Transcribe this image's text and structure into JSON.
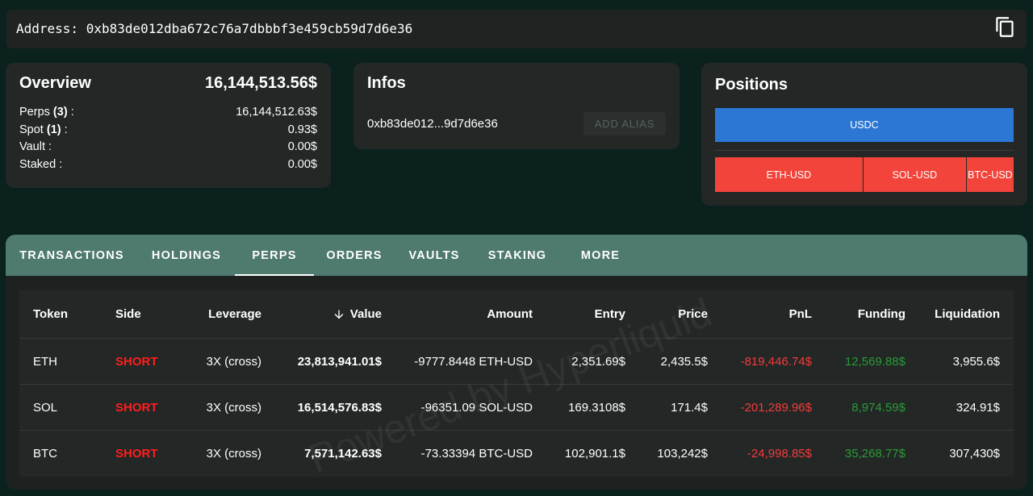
{
  "address_bar": {
    "label": "Address:",
    "address": "0xb83de012dba672c76a7dbbbf3e459cb59d7d6e36"
  },
  "overview": {
    "title": "Overview",
    "total": "16,144,513.56$",
    "rows": [
      {
        "label": "Perps",
        "count": "(3)",
        "sep": ":",
        "value": "16,144,512.63$"
      },
      {
        "label": "Spot",
        "count": "(1)",
        "sep": ":",
        "value": "0.93$"
      },
      {
        "label": "Vault",
        "count": "",
        "sep": ":",
        "value": "0.00$"
      },
      {
        "label": "Staked",
        "count": "",
        "sep": ":",
        "value": "0.00$"
      }
    ]
  },
  "infos": {
    "title": "Infos",
    "short_address": "0xb83de012...9d7d6e36",
    "add_alias_label": "ADD ALIAS"
  },
  "positions": {
    "title": "Positions",
    "spot": [
      {
        "label": "USDC",
        "share": 1.0
      }
    ],
    "perps": [
      {
        "label": "ETH-USD",
        "share": 0.497
      },
      {
        "label": "SOL-USD",
        "share": 0.345
      },
      {
        "label": "BTC-USD",
        "share": 0.158
      }
    ]
  },
  "tabs": {
    "items": [
      "TRANSACTIONS",
      "HOLDINGS",
      "PERPS",
      "ORDERS",
      "VAULTS",
      "STAKING",
      "MORE"
    ],
    "active": "PERPS"
  },
  "perps_table": {
    "columns": [
      "Token",
      "Side",
      "Leverage",
      "Value",
      "Amount",
      "Entry",
      "Price",
      "PnL",
      "Funding",
      "Liquidation"
    ],
    "rows": [
      {
        "token": "ETH",
        "side": "SHORT",
        "leverage": "3X (cross)",
        "value": "23,813,941.01$",
        "amount": "-9777.8448 ETH-USD",
        "entry": "2,351.69$",
        "price": "2,435.5$",
        "pnl": "-819,446.74$",
        "funding": "12,569.88$",
        "liquidation": "3,955.6$"
      },
      {
        "token": "SOL",
        "side": "SHORT",
        "leverage": "3X (cross)",
        "value": "16,514,576.83$",
        "amount": "-96351.09 SOL-USD",
        "entry": "169.3108$",
        "price": "171.4$",
        "pnl": "-201,289.96$",
        "funding": "8,974.59$",
        "liquidation": "324.91$"
      },
      {
        "token": "BTC",
        "side": "SHORT",
        "leverage": "3X (cross)",
        "value": "7,571,142.63$",
        "amount": "-73.33394 BTC-USD",
        "entry": "102,901.1$",
        "price": "103,242$",
        "pnl": "-24,998.85$",
        "funding": "35,268.77$",
        "liquidation": "307,430$"
      }
    ]
  },
  "watermark": "Powered by Hyperliquid",
  "icons": {
    "copy": "copy-icon",
    "sort": "arrow-down-icon"
  },
  "colors": {
    "bg": "#0b211d",
    "card": "#232726",
    "tab_bar": "#4f7a6f",
    "usdc": "#2c77d3",
    "perp": "#f2443a",
    "short": "#ff1e1e",
    "pnl_negative": "#f53b3b",
    "funding_positive": "#2a9b35"
  }
}
